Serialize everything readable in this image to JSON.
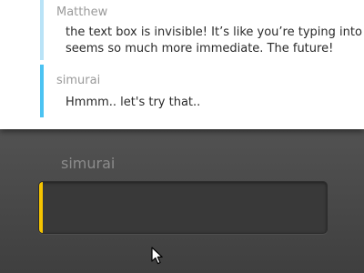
{
  "messages": [
    {
      "author": "Matthew",
      "lines": [
        "the text box is invisible! It’s like you’re typing into t",
        "seems so much more immediate. The future!"
      ]
    },
    {
      "author": "simurai",
      "lines": [
        "Hmmm.. let's try that.."
      ]
    }
  ],
  "composer": {
    "username": "simurai",
    "input_value": ""
  },
  "colors": {
    "accent_previous": "#b9e3f7",
    "accent_current": "#4cc3f2",
    "accent_input": "#f5c400"
  },
  "icons": {
    "cursor": "mouse-pointer-icon"
  }
}
